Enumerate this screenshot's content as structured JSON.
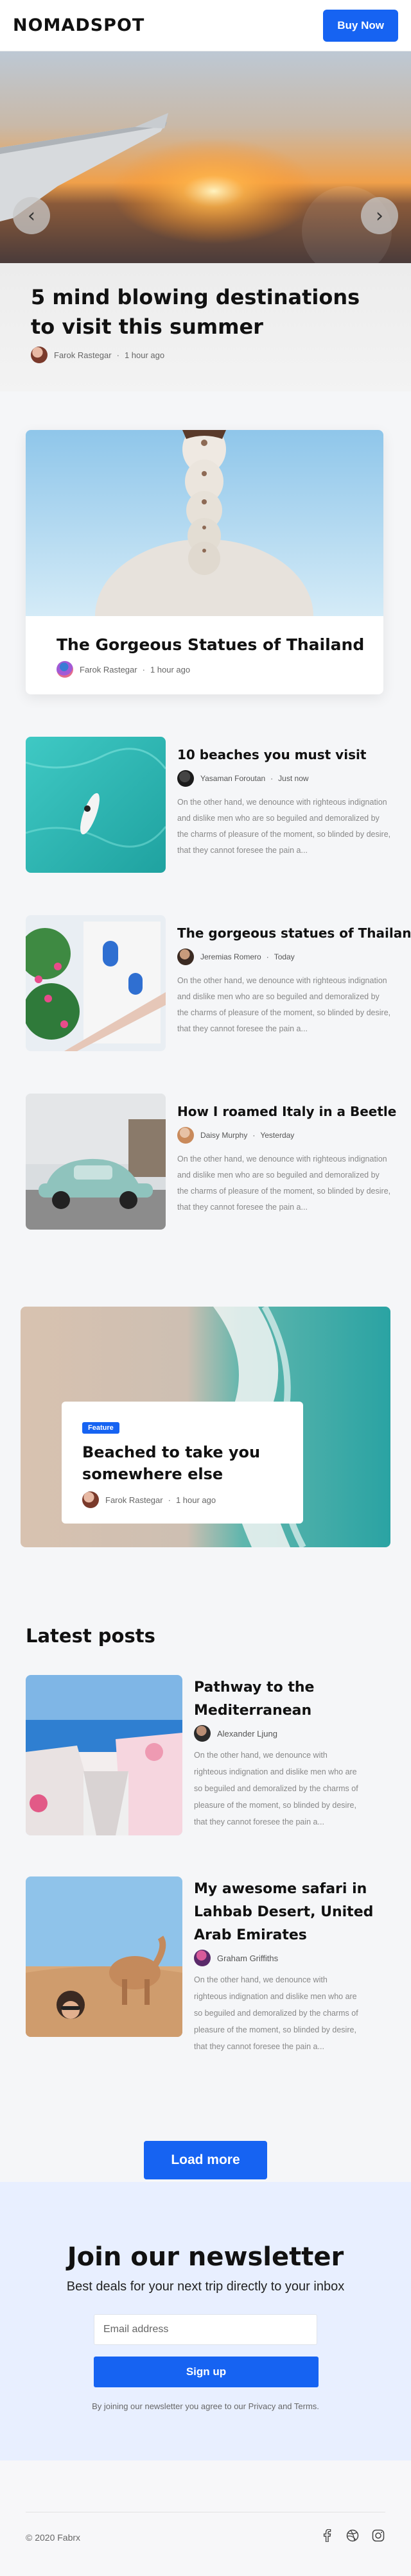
{
  "header": {
    "logo": "NOMADSPOT",
    "cta_label": "Buy Now"
  },
  "hero": {
    "title": "5 mind blowing destinations to visit this summer",
    "author": "Farok Rastegar",
    "time": "1 hour ago",
    "prev_icon": "chevron-left-icon",
    "next_icon": "chevron-right-icon"
  },
  "featured": {
    "title": "The Gorgeous Statues of Thailand",
    "author": "Farok Rastegar",
    "time": "1 hour ago"
  },
  "posts": [
    {
      "title": "10 beaches you must visit",
      "author": "Yasaman Foroutan",
      "time": "Just now",
      "excerpt_lines": [
        "On the other hand, we denounce with righteous indignation",
        "and dislike men who are so beguiled and demoralized by",
        "the charms of pleasure of the moment, so blinded by desire,",
        "that they cannot foresee the pain a..."
      ]
    },
    {
      "title": "The gorgeous statues of Thailand",
      "author": "Jeremias Romero",
      "time": "Today",
      "excerpt_lines": [
        "On the other hand, we denounce with righteous indignation",
        "and dislike men who are so beguiled and demoralized by",
        "the charms of pleasure of the moment, so blinded by desire,",
        "that they cannot foresee the pain a..."
      ]
    },
    {
      "title": "How I roamed Italy in a Beetle",
      "author": "Daisy Murphy",
      "time": "Yesterday",
      "excerpt_lines": [
        "On the other hand, we denounce with righteous indignation",
        "and dislike men who are so beguiled and demoralized by",
        "the charms of pleasure of the moment, so blinded by desire,",
        "that they cannot foresee the pain a..."
      ]
    }
  ],
  "beach_feature": {
    "badge": "Feature",
    "title": "Beached to take you somewhere else",
    "author": "Farok Rastegar",
    "time": "1 hour ago"
  },
  "latest": {
    "heading": "Latest posts",
    "items": [
      {
        "title": "Pathway to the Mediterranean",
        "author": "Alexander Ljung",
        "excerpt": "On the other hand, we denounce with righteous indignation and dislike men who are so beguiled and demoralized by the charms of pleasure of the moment, so blinded by desire, that they cannot foresee the pain a..."
      },
      {
        "title": "My awesome safari in Lahbab Desert, United Arab Emirates",
        "author": "Graham Griffiths",
        "excerpt": "On the other hand, we denounce with righteous indignation and dislike men who are so beguiled and demoralized by the charms of pleasure of the moment, so blinded by desire, that they cannot foresee the pain a..."
      }
    ],
    "load_more": "Load more"
  },
  "newsletter": {
    "title": "Join our newsletter",
    "subtitle": "Best deals for your next trip directly to your inbox",
    "email_placeholder": "Email address",
    "button": "Sign up",
    "note": "By joining our newsletter you agree to our Privacy and Terms."
  },
  "footer": {
    "copyright": "© 2020 Fabrx",
    "social_icons": [
      "facebook-icon",
      "dribbble-icon",
      "instagram-icon"
    ]
  },
  "colors": {
    "accent": "#1663f2",
    "newsletter_bg": "#e8efff"
  }
}
